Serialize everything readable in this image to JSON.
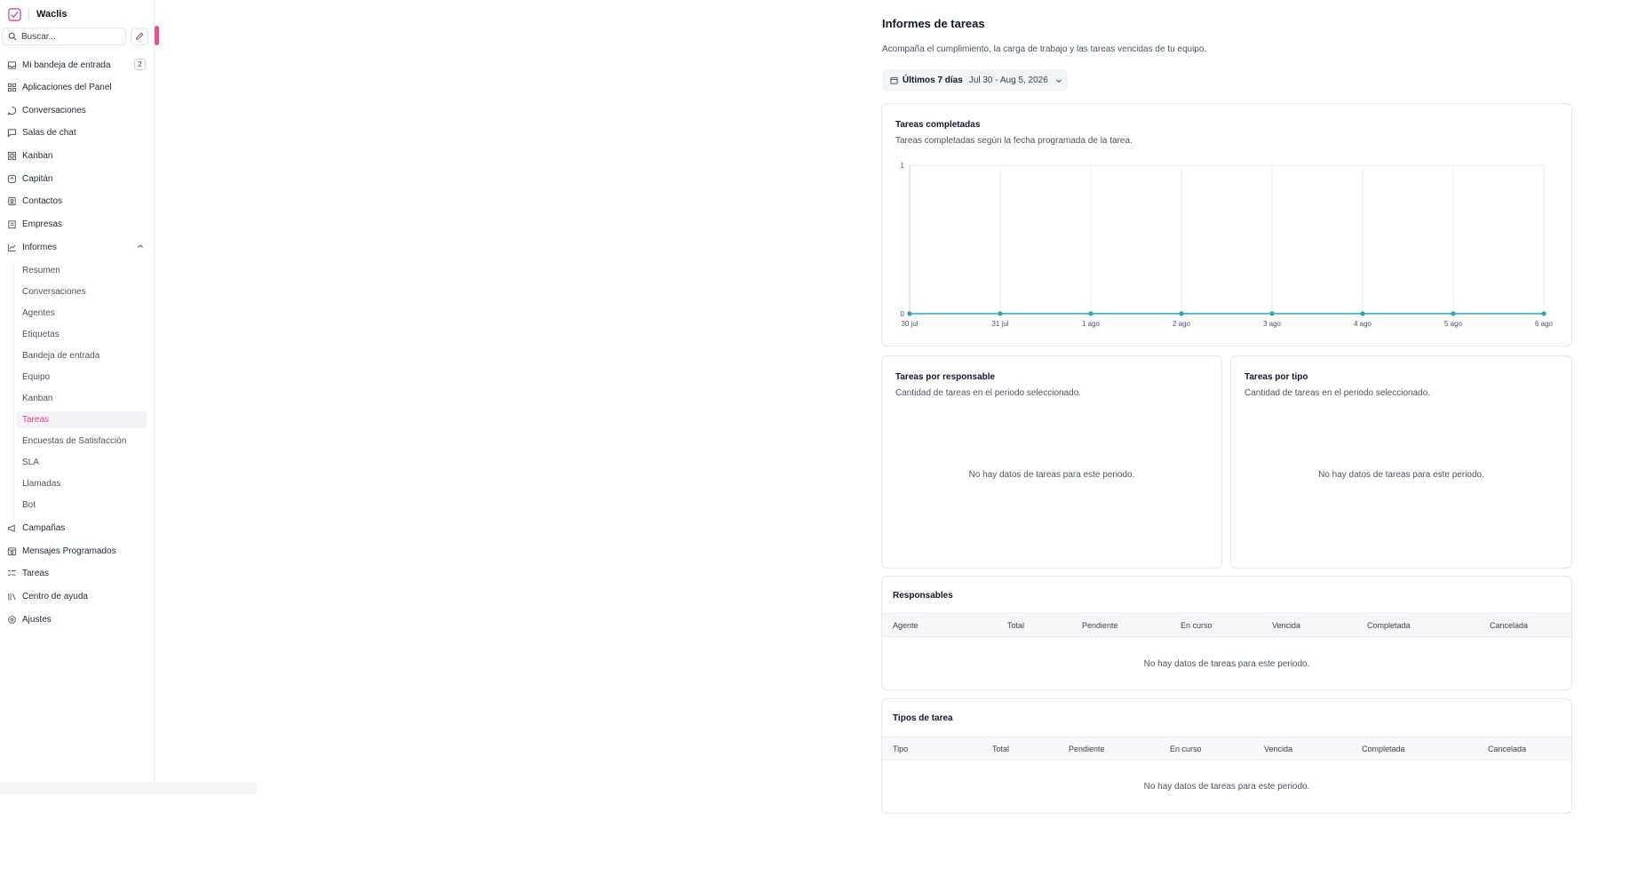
{
  "app": {
    "name": "Waclis",
    "accent_color": "#e2408a",
    "chart_color": "#2aa6b8"
  },
  "search": {
    "placeholder": "Buscar..."
  },
  "sidebar": {
    "items": [
      {
        "label": "Mi bandeja de entrada",
        "icon": "inbox-icon",
        "badge": "2"
      },
      {
        "label": "Aplicaciones del Panel",
        "icon": "apps-icon"
      },
      {
        "label": "Conversaciones",
        "icon": "chat-bubble-icon"
      },
      {
        "label": "Salas de chat",
        "icon": "message-square-icon"
      },
      {
        "label": "Kanban",
        "icon": "kanban-icon"
      },
      {
        "label": "Capitán",
        "icon": "captain-icon"
      },
      {
        "label": "Contactos",
        "icon": "contacts-icon"
      },
      {
        "label": "Empresas",
        "icon": "building-icon"
      },
      {
        "label": "Informes",
        "icon": "chart-icon",
        "expanded": true
      }
    ],
    "report_items": [
      {
        "label": "Resumen"
      },
      {
        "label": "Conversaciones"
      },
      {
        "label": "Agentes"
      },
      {
        "label": "Etiquetas"
      },
      {
        "label": "Bandeja de entrada"
      },
      {
        "label": "Equipo"
      },
      {
        "label": "Kanban"
      },
      {
        "label": "Tareas",
        "active": true
      },
      {
        "label": "Encuestas de Satisfacción"
      },
      {
        "label": "SLA"
      },
      {
        "label": "Llamadas"
      },
      {
        "label": "Bot"
      }
    ],
    "bottom_items": [
      {
        "label": "Campañas",
        "icon": "megaphone-icon"
      },
      {
        "label": "Mensajes Programados",
        "icon": "calendar-clock-icon"
      },
      {
        "label": "Tareas",
        "icon": "tasks-icon"
      },
      {
        "label": "Centro de ayuda",
        "icon": "library-icon"
      },
      {
        "label": "Ajustes",
        "icon": "settings-icon"
      }
    ]
  },
  "main": {
    "title": "Informes de tareas",
    "subtitle": "Acompaña el cumplimiento, la carga de trabajo y las tareas vencidas de tu equipo.",
    "date_filter": {
      "label": "Últimos 7 días",
      "range": "Jul 30 - Aug 5, 2026"
    },
    "completed_card": {
      "title": "Tareas completadas",
      "description": "Tareas completadas según la fecha programada de la tarea."
    },
    "by_assignee": {
      "title": "Tareas por responsable",
      "description": "Cantidad de tareas en el periodo seleccionado.",
      "empty": "No hay datos de tareas para este periodo."
    },
    "by_type": {
      "title": "Tareas por tipo",
      "description": "Cantidad de tareas en el periodo seleccionado.",
      "empty": "No hay datos de tareas para este periodo."
    },
    "assignees_table": {
      "title": "Responsables",
      "columns": [
        "Agente",
        "Total",
        "Pendiente",
        "En curso",
        "Vencida",
        "Completada",
        "Cancelada"
      ],
      "empty": "No hay datos de tareas para este periodo."
    },
    "types_table": {
      "title": "Tipos de tarea",
      "columns": [
        "Tipo",
        "Total",
        "Pendiente",
        "En curso",
        "Vencida",
        "Completada",
        "Cancelada"
      ],
      "empty": "No hay datos de tareas para este periodo."
    }
  },
  "chart_data": {
    "type": "line",
    "title": "Tareas completadas",
    "categories": [
      "30 jul",
      "31 jul",
      "1 ago",
      "2 ago",
      "3 ago",
      "4 ago",
      "5 ago",
      "6 ago"
    ],
    "series": [
      {
        "values": [
          0,
          0,
          0,
          0,
          0,
          0,
          0,
          0
        ]
      }
    ],
    "ylim": [
      0,
      1
    ],
    "yticks": [
      "0",
      "1"
    ],
    "grid": true,
    "legend": "none"
  }
}
